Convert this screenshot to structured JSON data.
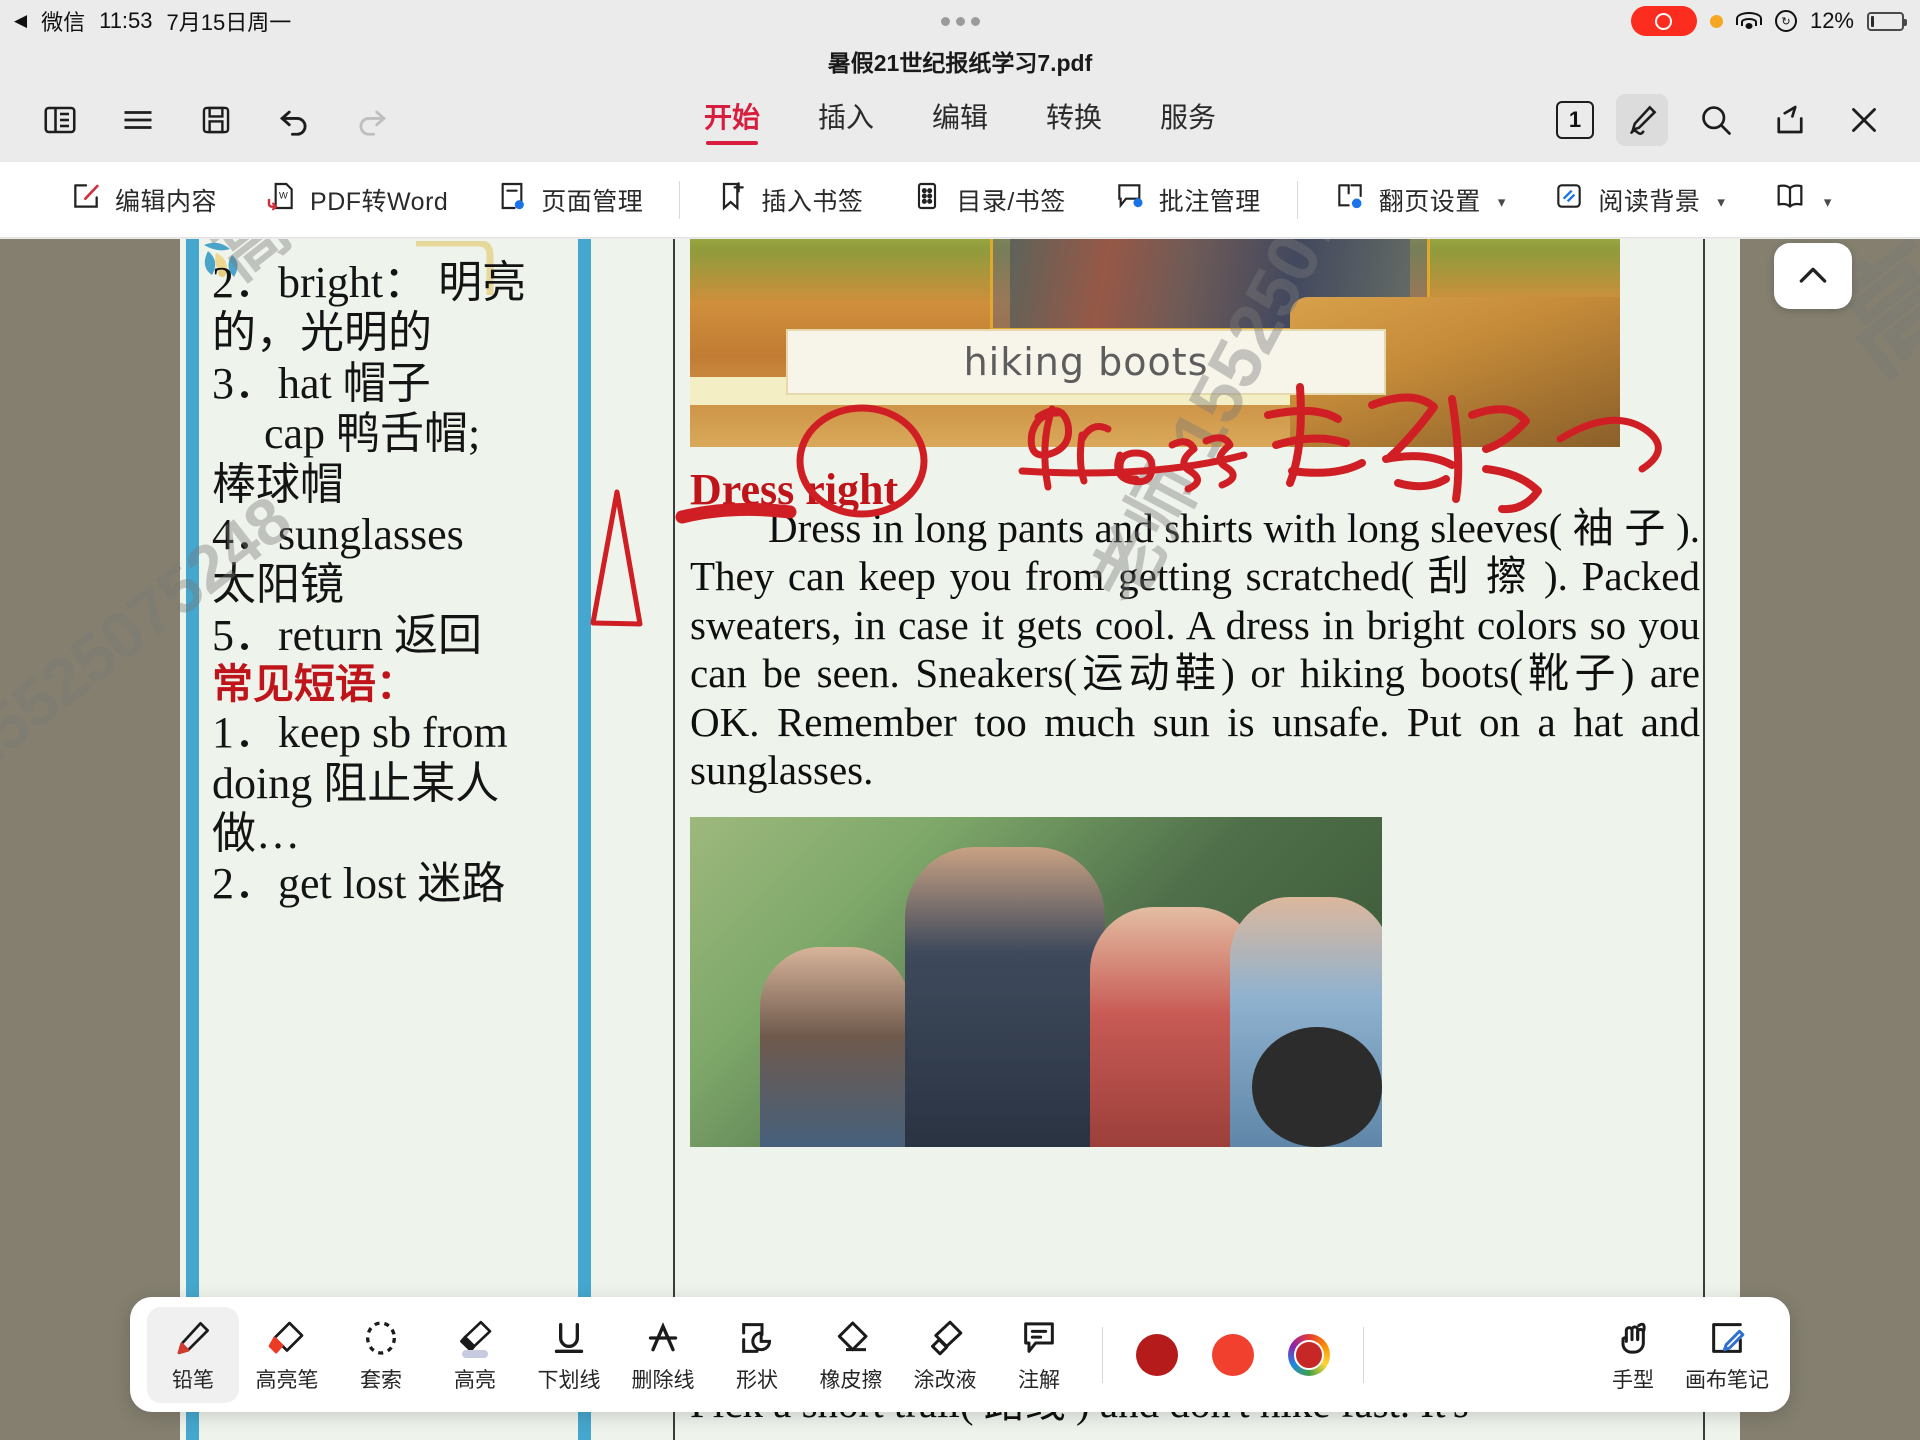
{
  "statusbar": {
    "back_label": "◀",
    "app_name": "微信",
    "time": "11:53",
    "date": "7月15日周一",
    "battery_percent": "12%",
    "recording_icon": "record-indicator",
    "wifi_icon": "wifi-icon",
    "orientation_lock_icon": "rotation-lock-icon"
  },
  "document": {
    "title": "暑假21世纪报纸学习7.pdf"
  },
  "ribbon": {
    "left_icons": [
      {
        "name": "sidebar-toggle-icon",
        "label": "侧边栏"
      },
      {
        "name": "menu-icon",
        "label": "菜单"
      },
      {
        "name": "save-icon",
        "label": "保存"
      },
      {
        "name": "undo-icon",
        "label": "撤销"
      },
      {
        "name": "redo-icon",
        "label": "重做"
      }
    ],
    "tabs": [
      {
        "label": "开始",
        "active": true
      },
      {
        "label": "插入",
        "active": false
      },
      {
        "label": "编辑",
        "active": false
      },
      {
        "label": "转换",
        "active": false
      },
      {
        "label": "服务",
        "active": false
      }
    ],
    "page_number": "1",
    "right_icons": [
      {
        "name": "pen-annotate-icon",
        "label": "批注",
        "selected": true
      },
      {
        "name": "search-icon",
        "label": "搜索",
        "selected": false
      },
      {
        "name": "share-icon",
        "label": "分享",
        "selected": false
      },
      {
        "name": "close-icon",
        "label": "关闭",
        "selected": false
      }
    ]
  },
  "subbar": {
    "items": [
      {
        "label": "编辑内容",
        "icon": "edit-content-icon",
        "caret": false
      },
      {
        "label": "PDF转Word",
        "icon": "pdf-to-word-icon",
        "caret": false
      },
      {
        "label": "页面管理",
        "icon": "page-manage-icon",
        "caret": false
      },
      {
        "label": "插入书签",
        "icon": "insert-bookmark-icon",
        "caret": false
      },
      {
        "label": "目录/书签",
        "icon": "toc-bookmark-icon",
        "caret": false
      },
      {
        "label": "批注管理",
        "icon": "annotation-manage-icon",
        "caret": false
      },
      {
        "label": "翻页设置",
        "icon": "page-flip-settings-icon",
        "caret": true
      },
      {
        "label": "阅读背景",
        "icon": "reading-background-icon",
        "caret": true
      },
      {
        "label": "",
        "icon": "book-view-icon",
        "caret": true
      }
    ]
  },
  "page_content": {
    "left_column": [
      "2．bright： 明亮",
      "的，光明的",
      "3．hat 帽子",
      "cap 鸭舌帽;",
      "棒球帽",
      "4．sunglasses",
      "太阳镜",
      "5．return 返回"
    ],
    "left_column_heading": "常见短语：",
    "left_column_phrases": [
      "1．keep sb from",
      "doing 阻止某人",
      "做…",
      "2．get lost 迷路"
    ],
    "photo_caption": "hiking boots",
    "section_heading": "Dress right",
    "body_text": "Dress in long pants and shirts with long sleeves( 袖 子 ). They can keep you from getting scratched( 刮 擦 ). Packed sweaters, in case it gets cool. A dress in bright colors so you can be seen. Sneakers(运动鞋) or hiking boots(靴子) are OK. Remember too much sun is unsafe. Put on a hat and sunglasses.",
    "bottom_text": "Pick a short trail( 路线 ) and don't hike fast. It's"
  },
  "annotations": {
    "handwritten_note": "dress 穿衣服",
    "marks": [
      "circle-around-right",
      "underline-under-dress",
      "triangle-left-margin",
      "red-scribble-top-right"
    ],
    "ink_color": "#d01f24"
  },
  "watermarks": [
    "高老师 15525075248",
    "15525075248",
    "高考",
    "老师 15525075248"
  ],
  "dock": {
    "tools": [
      {
        "label": "铅笔",
        "icon": "pencil-icon",
        "active": true
      },
      {
        "label": "高亮笔",
        "icon": "highlighter-pen-icon",
        "active": false
      },
      {
        "label": "套索",
        "icon": "lasso-icon",
        "active": false
      },
      {
        "label": "高亮",
        "icon": "highlight-icon",
        "active": false
      },
      {
        "label": "下划线",
        "icon": "underline-icon",
        "active": false
      },
      {
        "label": "删除线",
        "icon": "strikethrough-icon",
        "active": false
      },
      {
        "label": "形状",
        "icon": "shape-icon",
        "active": false
      },
      {
        "label": "橡皮擦",
        "icon": "eraser-icon",
        "active": false
      },
      {
        "label": "涂改液",
        "icon": "correction-fluid-icon",
        "active": false
      },
      {
        "label": "注解",
        "icon": "comment-icon",
        "active": false
      }
    ],
    "colors": [
      {
        "name": "dark-red-swatch",
        "hex": "#b51b1b"
      },
      {
        "name": "red-swatch",
        "hex": "#f2402e"
      },
      {
        "name": "color-picker-swatch",
        "hex": "#c62828"
      }
    ],
    "right_tools": [
      {
        "label": "手型",
        "icon": "hand-icon"
      },
      {
        "label": "画布笔记",
        "icon": "canvas-note-icon"
      }
    ]
  },
  "collapse_button": {
    "name": "collapse-toolbar-chevron",
    "icon": "chevron-up-icon"
  }
}
